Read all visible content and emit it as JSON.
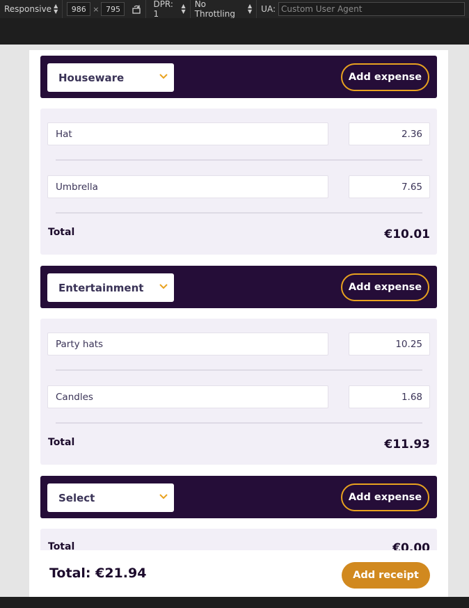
{
  "devtools": {
    "device_mode": "Responsive",
    "width": "986",
    "times": "×",
    "height": "795",
    "dpr": "DPR: 1",
    "throttling": "No Throttling",
    "ua_label": "UA:",
    "ua_placeholder": "Custom User Agent"
  },
  "categories": [
    {
      "select": "Houseware",
      "add_label": "Add expense",
      "expenses": [
        {
          "name": "Hat",
          "amount": "2.36"
        },
        {
          "name": "Umbrella",
          "amount": "7.65"
        }
      ],
      "total_label": "Total",
      "total_value": "€10.01"
    },
    {
      "select": "Entertainment",
      "add_label": "Add expense",
      "expenses": [
        {
          "name": "Party hats",
          "amount": "10.25"
        },
        {
          "name": "Candles",
          "amount": "1.68"
        }
      ],
      "total_label": "Total",
      "total_value": "€11.93"
    },
    {
      "select": "Select",
      "add_label": "Add expense",
      "expenses": [],
      "total_label": "Total",
      "total_value": "€0.00"
    }
  ],
  "footer": {
    "total": "Total: €21.94",
    "add_receipt": "Add receipt"
  },
  "colors": {
    "header_bg": "#250d38",
    "accent": "#e8a21f",
    "receipt_button": "#d1891f",
    "panel_bg": "#f2eff7"
  }
}
